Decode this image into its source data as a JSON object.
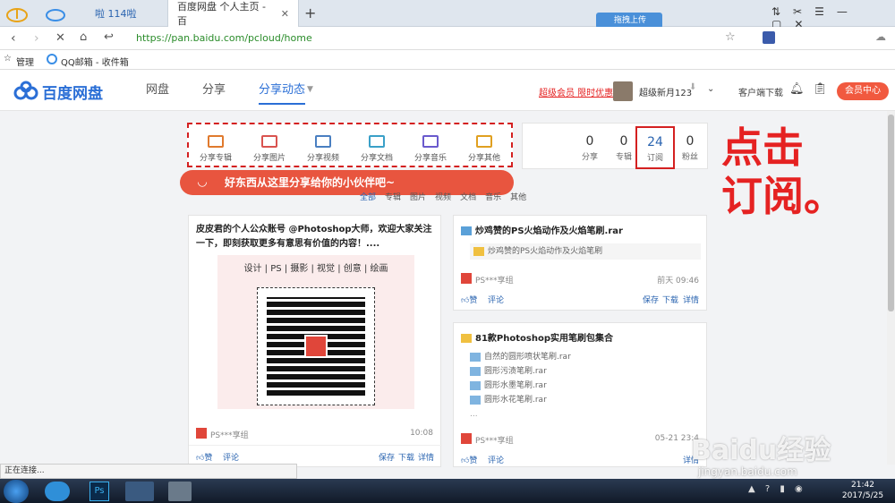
{
  "browser": {
    "tabs": [
      {
        "label": "啦 114啦"
      },
      {
        "label": "百度网盘 个人主页 - 百"
      }
    ],
    "new_tab": "+",
    "upload_badge": "拖拽上传",
    "url": "https://pan.baidu.com/pcloud/home",
    "bookmarks": [
      {
        "label": "管理"
      },
      {
        "label": "QQ邮箱 - 收件箱"
      }
    ],
    "status": "正在连接..."
  },
  "site": {
    "logo": "百度网盘",
    "nav": [
      "网盘",
      "分享",
      "分享动态"
    ],
    "promo": "超级会员 限时优惠",
    "username": "超级新月123",
    "client_download": "客户端下载",
    "vip_button": "会员中心"
  },
  "share_bar": {
    "items": [
      "分享专辑",
      "分享图片",
      "分享视频",
      "分享文档",
      "分享音乐",
      "分享其他"
    ],
    "banner": "好东西从这里分享给你的小伙伴吧~"
  },
  "stats": [
    {
      "value": "0",
      "label": "分享"
    },
    {
      "value": "0",
      "label": "专辑"
    },
    {
      "value": "24",
      "label": "订阅"
    },
    {
      "value": "0",
      "label": "粉丝"
    }
  ],
  "annotation": {
    "line1": "点击",
    "line2": "订阅。"
  },
  "filter_tabs": [
    "全部",
    "专辑",
    "图片",
    "视频",
    "文档",
    "音乐",
    "其他"
  ],
  "feed": {
    "left": {
      "title": "皮皮君的个人公众账号 @Photoshop大师，欢迎大家关注一下，即刻获取更多有意思有价值的内容！....",
      "tags": "设计 | PS | 摄影 | 视觉 | 创意 | 绘画",
      "author": "PS***享组",
      "time": "10:08",
      "like": "赞",
      "comment": "评论",
      "actions": [
        "保存",
        "下载",
        "详情"
      ]
    },
    "right1": {
      "title": "炒鸡赞的PS火焰动作及火焰笔刷.rar",
      "file": "炒鸡赞的PS火焰动作及火焰笔刷",
      "author": "PS***享组",
      "time": "前天 09:46",
      "like": "赞",
      "comment": "评论",
      "actions": [
        "保存",
        "下载",
        "详情"
      ]
    },
    "right2": {
      "title": "81款Photoshop实用笔刷包集合",
      "files": [
        "自然的圆形喷状笔刷.rar",
        "圆形污渍笔刷.rar",
        "圆形水墨笔刷.rar",
        "圆形水花笔刷.rar"
      ],
      "more": "...",
      "author": "PS***享组",
      "time": "05-21 23:4",
      "like": "赞",
      "comment": "评论",
      "actions": [
        "详情"
      ]
    }
  },
  "watermark": {
    "brand": "Baidu经验",
    "url": "jingyan.baidu.com"
  },
  "taskbar": {
    "time": "21:42",
    "date": "2017/5/25"
  },
  "colors": {
    "accent": "#2a64b0",
    "red": "#e52222",
    "banner": "#e8553f",
    "vip": "#f1593f"
  }
}
